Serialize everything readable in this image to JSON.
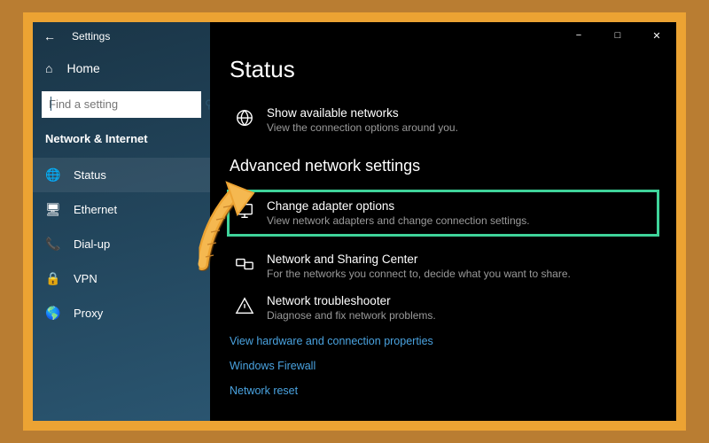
{
  "window": {
    "title": "Settings"
  },
  "sidebar": {
    "home_label": "Home",
    "search_placeholder": "Find a setting",
    "category_label": "Network & Internet",
    "items": [
      {
        "icon": "globe-network-icon",
        "label": "Status"
      },
      {
        "icon": "ethernet-icon",
        "label": "Ethernet"
      },
      {
        "icon": "dialup-icon",
        "label": "Dial-up"
      },
      {
        "icon": "vpn-icon",
        "label": "VPN"
      },
      {
        "icon": "proxy-icon",
        "label": "Proxy"
      }
    ]
  },
  "main": {
    "heading": "Status",
    "available_networks": {
      "title": "Show available networks",
      "desc": "View the connection options around you."
    },
    "advanced_heading": "Advanced network settings",
    "change_adapter": {
      "title": "Change adapter options",
      "desc": "View network adapters and change connection settings."
    },
    "sharing_center": {
      "title": "Network and Sharing Center",
      "desc": "For the networks you connect to, decide what you want to share."
    },
    "troubleshooter": {
      "title": "Network troubleshooter",
      "desc": "Diagnose and fix network problems."
    },
    "links": [
      "View hardware and connection properties",
      "Windows Firewall",
      "Network reset"
    ]
  },
  "colors": {
    "highlight": "#3fd39a",
    "link": "#4aa3e0",
    "frame": "#eca333"
  }
}
